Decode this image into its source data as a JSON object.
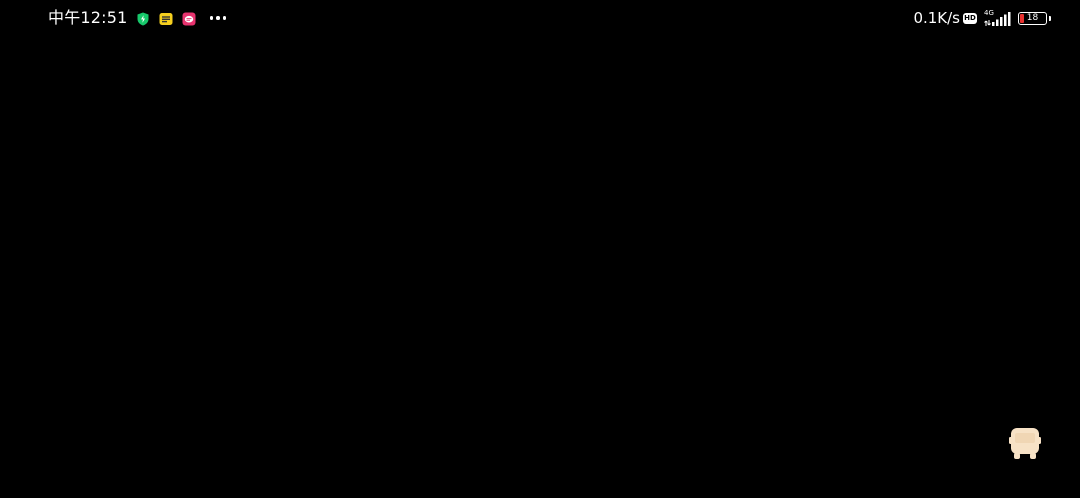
{
  "status_bar": {
    "time": "中午12:51",
    "notification_icons": [
      "shield-icon",
      "news-app-icon",
      "message-app-icon"
    ],
    "more_indicator": "more-dots-icon",
    "network_speed": "0.1K/s",
    "hd_badge": "HD",
    "network_type": "4G",
    "signal_bars": 4,
    "battery_level": "18",
    "battery_fraction": 0.18,
    "battery_fill_color": "#e8312f"
  },
  "screen": {
    "background_color": "#000000",
    "floating_button_icon": "bus-icon",
    "floating_button_color": "#f7e2c6"
  }
}
